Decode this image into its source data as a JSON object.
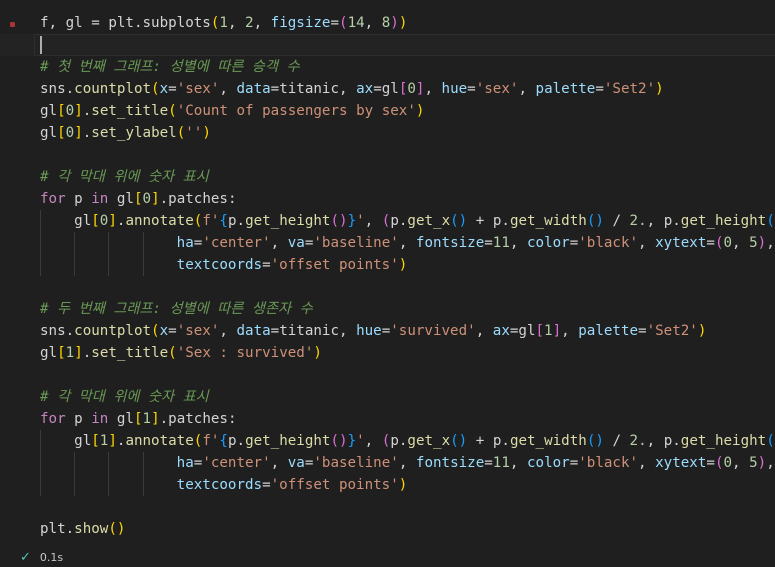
{
  "cell": {
    "status": {
      "icon": "check-icon",
      "duration": "0.1s"
    },
    "lines": [
      [
        [
          "f, gl = plt.subplots",
          ""
        ],
        [
          "(",
          "p1"
        ],
        [
          "1",
          "num"
        ],
        [
          ", ",
          ""
        ],
        [
          "2",
          "num"
        ],
        [
          ", ",
          ""
        ],
        [
          "figsize",
          "prm"
        ],
        [
          "=",
          ""
        ],
        [
          "(",
          "p2"
        ],
        [
          "14",
          "num"
        ],
        [
          ", ",
          ""
        ],
        [
          "8",
          "num"
        ],
        [
          ")",
          "p2"
        ],
        [
          ")",
          "p1"
        ]
      ],
      [],
      [
        [
          "# 첫 번째 그래프: 성별에 따른 승객 수",
          "cmt"
        ]
      ],
      [
        [
          "sns.",
          ""
        ],
        [
          "countplot",
          "fn"
        ],
        [
          "(",
          "p1"
        ],
        [
          "x",
          "prm"
        ],
        [
          "=",
          ""
        ],
        [
          "'sex'",
          "str"
        ],
        [
          ", ",
          ""
        ],
        [
          "data",
          "prm"
        ],
        [
          "=titanic, ",
          ""
        ],
        [
          "ax",
          "prm"
        ],
        [
          "=gl",
          ""
        ],
        [
          "[",
          "p2"
        ],
        [
          "0",
          "num"
        ],
        [
          "]",
          "p2"
        ],
        [
          ", ",
          ""
        ],
        [
          "hue",
          "prm"
        ],
        [
          "=",
          ""
        ],
        [
          "'sex'",
          "str"
        ],
        [
          ", ",
          ""
        ],
        [
          "palette",
          "prm"
        ],
        [
          "=",
          ""
        ],
        [
          "'Set2'",
          "str"
        ],
        [
          ")",
          "p1"
        ]
      ],
      [
        [
          "gl",
          ""
        ],
        [
          "[",
          "p1"
        ],
        [
          "0",
          "num"
        ],
        [
          "]",
          "p1"
        ],
        [
          ".",
          ""
        ],
        [
          "set_title",
          "fn"
        ],
        [
          "(",
          "p1"
        ],
        [
          "'Count of passengers by sex'",
          "str"
        ],
        [
          ")",
          "p1"
        ]
      ],
      [
        [
          "gl",
          ""
        ],
        [
          "[",
          "p1"
        ],
        [
          "0",
          "num"
        ],
        [
          "]",
          "p1"
        ],
        [
          ".",
          ""
        ],
        [
          "set_ylabel",
          "fn"
        ],
        [
          "(",
          "p1"
        ],
        [
          "''",
          "str"
        ],
        [
          ")",
          "p1"
        ]
      ],
      [],
      [
        [
          "# 각 막대 위에 숫자 표시",
          "cmt"
        ]
      ],
      [
        [
          "for",
          "kw"
        ],
        [
          " p ",
          ""
        ],
        [
          "in",
          "kw"
        ],
        [
          " gl",
          ""
        ],
        [
          "[",
          "p1"
        ],
        [
          "0",
          "num"
        ],
        [
          "]",
          "p1"
        ],
        [
          ".patches:",
          ""
        ]
      ],
      [
        [
          "    gl",
          ""
        ],
        [
          "[",
          "p1"
        ],
        [
          "0",
          "num"
        ],
        [
          "]",
          "p1"
        ],
        [
          ".",
          ""
        ],
        [
          "annotate",
          "fn"
        ],
        [
          "(",
          "p1"
        ],
        [
          "f'",
          "str"
        ],
        [
          "{",
          "p3"
        ],
        [
          "p.",
          ""
        ],
        [
          "get_height",
          "fn"
        ],
        [
          "()",
          "p2"
        ],
        [
          "}",
          "p3"
        ],
        [
          "'",
          "str"
        ],
        [
          ", ",
          ""
        ],
        [
          "(",
          "p2"
        ],
        [
          "p.",
          ""
        ],
        [
          "get_x",
          "fn"
        ],
        [
          "()",
          "p3"
        ],
        [
          " + p.",
          ""
        ],
        [
          "get_width",
          "fn"
        ],
        [
          "()",
          "p3"
        ],
        [
          " / ",
          ""
        ],
        [
          "2.",
          "num"
        ],
        [
          ", p.",
          ""
        ],
        [
          "get_height",
          "fn"
        ],
        [
          "()",
          "p3"
        ],
        [
          ")",
          "p2"
        ],
        [
          ",",
          ""
        ]
      ],
      [
        [
          "                ",
          ""
        ],
        [
          "ha",
          "prm"
        ],
        [
          "=",
          ""
        ],
        [
          "'center'",
          "str"
        ],
        [
          ", ",
          ""
        ],
        [
          "va",
          "prm"
        ],
        [
          "=",
          ""
        ],
        [
          "'baseline'",
          "str"
        ],
        [
          ", ",
          ""
        ],
        [
          "fontsize",
          "prm"
        ],
        [
          "=",
          ""
        ],
        [
          "11",
          "num"
        ],
        [
          ", ",
          ""
        ],
        [
          "color",
          "prm"
        ],
        [
          "=",
          ""
        ],
        [
          "'black'",
          "str"
        ],
        [
          ", ",
          ""
        ],
        [
          "xytext",
          "prm"
        ],
        [
          "=",
          ""
        ],
        [
          "(",
          "p2"
        ],
        [
          "0",
          "num"
        ],
        [
          ", ",
          ""
        ],
        [
          "5",
          "num"
        ],
        [
          ")",
          "p2"
        ],
        [
          ",",
          ""
        ]
      ],
      [
        [
          "                ",
          ""
        ],
        [
          "textcoords",
          "prm"
        ],
        [
          "=",
          ""
        ],
        [
          "'offset points'",
          "str"
        ],
        [
          ")",
          "p1"
        ]
      ],
      [],
      [
        [
          "# 두 번째 그래프: 성별에 따른 생존자 수",
          "cmt"
        ]
      ],
      [
        [
          "sns.",
          ""
        ],
        [
          "countplot",
          "fn"
        ],
        [
          "(",
          "p1"
        ],
        [
          "x",
          "prm"
        ],
        [
          "=",
          ""
        ],
        [
          "'sex'",
          "str"
        ],
        [
          ", ",
          ""
        ],
        [
          "data",
          "prm"
        ],
        [
          "=titanic, ",
          ""
        ],
        [
          "hue",
          "prm"
        ],
        [
          "=",
          ""
        ],
        [
          "'survived'",
          "str"
        ],
        [
          ", ",
          ""
        ],
        [
          "ax",
          "prm"
        ],
        [
          "=gl",
          ""
        ],
        [
          "[",
          "p2"
        ],
        [
          "1",
          "num"
        ],
        [
          "]",
          "p2"
        ],
        [
          ", ",
          ""
        ],
        [
          "palette",
          "prm"
        ],
        [
          "=",
          ""
        ],
        [
          "'Set2'",
          "str"
        ],
        [
          ")",
          "p1"
        ]
      ],
      [
        [
          "gl",
          ""
        ],
        [
          "[",
          "p1"
        ],
        [
          "1",
          "num"
        ],
        [
          "]",
          "p1"
        ],
        [
          ".",
          ""
        ],
        [
          "set_title",
          "fn"
        ],
        [
          "(",
          "p1"
        ],
        [
          "'Sex : survived'",
          "str"
        ],
        [
          ")",
          "p1"
        ]
      ],
      [],
      [
        [
          "# 각 막대 위에 숫자 표시",
          "cmt"
        ]
      ],
      [
        [
          "for",
          "kw"
        ],
        [
          " p ",
          ""
        ],
        [
          "in",
          "kw"
        ],
        [
          " gl",
          ""
        ],
        [
          "[",
          "p1"
        ],
        [
          "1",
          "num"
        ],
        [
          "]",
          "p1"
        ],
        [
          ".patches:",
          ""
        ]
      ],
      [
        [
          "    gl",
          ""
        ],
        [
          "[",
          "p1"
        ],
        [
          "1",
          "num"
        ],
        [
          "]",
          "p1"
        ],
        [
          ".",
          ""
        ],
        [
          "annotate",
          "fn"
        ],
        [
          "(",
          "p1"
        ],
        [
          "f'",
          "str"
        ],
        [
          "{",
          "p3"
        ],
        [
          "p.",
          ""
        ],
        [
          "get_height",
          "fn"
        ],
        [
          "()",
          "p2"
        ],
        [
          "}",
          "p3"
        ],
        [
          "'",
          "str"
        ],
        [
          ", ",
          ""
        ],
        [
          "(",
          "p2"
        ],
        [
          "p.",
          ""
        ],
        [
          "get_x",
          "fn"
        ],
        [
          "()",
          "p3"
        ],
        [
          " + p.",
          ""
        ],
        [
          "get_width",
          "fn"
        ],
        [
          "()",
          "p3"
        ],
        [
          " / ",
          ""
        ],
        [
          "2.",
          "num"
        ],
        [
          ", p.",
          ""
        ],
        [
          "get_height",
          "fn"
        ],
        [
          "()",
          "p3"
        ],
        [
          ")",
          "p2"
        ],
        [
          ",",
          ""
        ]
      ],
      [
        [
          "                ",
          ""
        ],
        [
          "ha",
          "prm"
        ],
        [
          "=",
          ""
        ],
        [
          "'center'",
          "str"
        ],
        [
          ", ",
          ""
        ],
        [
          "va",
          "prm"
        ],
        [
          "=",
          ""
        ],
        [
          "'baseline'",
          "str"
        ],
        [
          ", ",
          ""
        ],
        [
          "fontsize",
          "prm"
        ],
        [
          "=",
          ""
        ],
        [
          "11",
          "num"
        ],
        [
          ", ",
          ""
        ],
        [
          "color",
          "prm"
        ],
        [
          "=",
          ""
        ],
        [
          "'black'",
          "str"
        ],
        [
          ", ",
          ""
        ],
        [
          "xytext",
          "prm"
        ],
        [
          "=",
          ""
        ],
        [
          "(",
          "p2"
        ],
        [
          "0",
          "num"
        ],
        [
          ", ",
          ""
        ],
        [
          "5",
          "num"
        ],
        [
          ")",
          "p2"
        ],
        [
          ",",
          ""
        ]
      ],
      [
        [
          "                ",
          ""
        ],
        [
          "textcoords",
          "prm"
        ],
        [
          "=",
          ""
        ],
        [
          "'offset points'",
          "str"
        ],
        [
          ")",
          "p1"
        ]
      ],
      [],
      [
        [
          "plt.",
          ""
        ],
        [
          "show",
          "fn"
        ],
        [
          "()",
          "p1"
        ]
      ]
    ]
  }
}
